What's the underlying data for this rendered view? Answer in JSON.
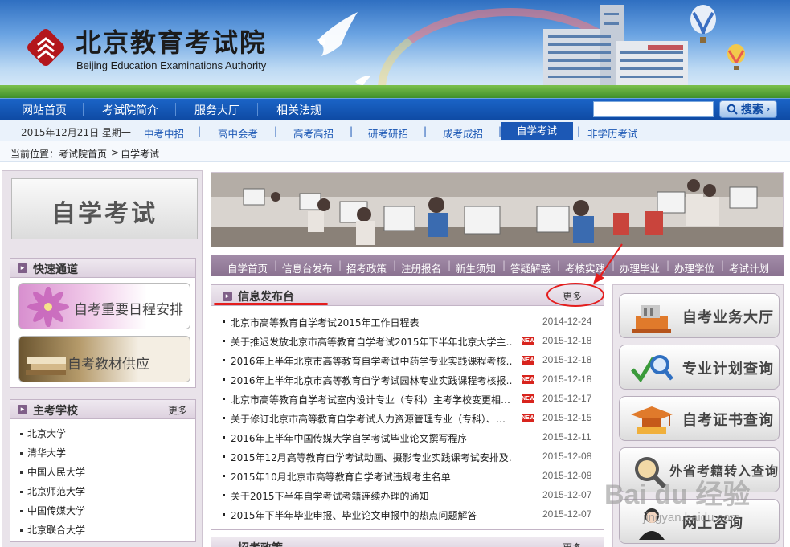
{
  "header": {
    "logo_cn": "北京教育考试院",
    "logo_en": "Beijing Education Examinations Authority"
  },
  "main_nav": {
    "items": [
      "网站首页",
      "考试院简介",
      "服务大厅",
      "相关法规"
    ],
    "search_label": "搜索"
  },
  "sub_nav": {
    "date": "2015年12月21日 星期一",
    "items": [
      "中考中招",
      "高中会考",
      "高考高招",
      "研考研招",
      "成考成招",
      "自学考试",
      "非学历考试"
    ]
  },
  "breadcrumb": {
    "label": "当前位置：",
    "home": "考试院首页",
    "sep": ">",
    "current": "自学考试"
  },
  "left": {
    "title": "自学考试",
    "quick": {
      "title": "快速通道",
      "items": [
        "自考重要日程安排",
        "自考教材供应"
      ]
    },
    "schools": {
      "title": "主考学校",
      "more": "更多",
      "items": [
        "北京大学",
        "清华大学",
        "中国人民大学",
        "北京师范大学",
        "中国传媒大学",
        "北京联合大学"
      ]
    }
  },
  "menu": {
    "items": [
      "自学首页",
      "信息台发布",
      "招考政策",
      "注册报名",
      "新生须知",
      "答疑解惑",
      "考核实践",
      "办理毕业",
      "办理学位",
      "考试计划"
    ]
  },
  "news": {
    "title": "信息发布台",
    "more": "更多",
    "new_badge": "NEW",
    "items": [
      {
        "title": "北京市高等教育自学考试2015年工作日程表",
        "date": "2014-12-24",
        "new": false
      },
      {
        "title": "关于推迟发放北京市高等教育自学考试2015年下半年北京大学主…",
        "date": "2015-12-18",
        "new": true
      },
      {
        "title": "2016年上半年北京市高等教育自学考试中药学专业实践课程考核…",
        "date": "2015-12-18",
        "new": true
      },
      {
        "title": "2016年上半年北京市高等教育自学考试园林专业实践课程考核报…",
        "date": "2015-12-18",
        "new": true
      },
      {
        "title": "北京市高等教育自学考试室内设计专业（专科）主考学校变更相…",
        "date": "2015-12-17",
        "new": true
      },
      {
        "title": "关于修订北京市高等教育自学考试人力资源管理专业（专科）、…",
        "date": "2015-12-15",
        "new": true
      },
      {
        "title": "2016年上半年中国传媒大学自学考试毕业论文撰写程序",
        "date": "2015-12-11",
        "new": false
      },
      {
        "title": "2015年12月高等教育自学考试动画、摄影专业实践课考试安排及…",
        "date": "2015-12-08",
        "new": false
      },
      {
        "title": "2015年10月北京市高等教育自学考试违规考生名单",
        "date": "2015-12-08",
        "new": false
      },
      {
        "title": "关于2015下半年自学考试考籍连续办理的通知",
        "date": "2015-12-07",
        "new": false
      },
      {
        "title": "2015年下半年毕业申报、毕业论文申报中的热点问题解答",
        "date": "2015-12-07",
        "new": false
      }
    ]
  },
  "news2": {
    "title": "招考政策",
    "more": "更多"
  },
  "right": {
    "items": [
      "自考业务大厅",
      "专业计划查询",
      "自考证书查询",
      "外省考籍转入查询",
      "网上咨询"
    ]
  },
  "watermark": {
    "brand": "Bai du 经验",
    "url": "jingyan.baidu.com"
  },
  "colors": {
    "nav_blue": "#0e4aa3",
    "accent_purple": "#8a7290",
    "annotation_red": "#e41d1d",
    "new_badge": "#d8241d"
  }
}
